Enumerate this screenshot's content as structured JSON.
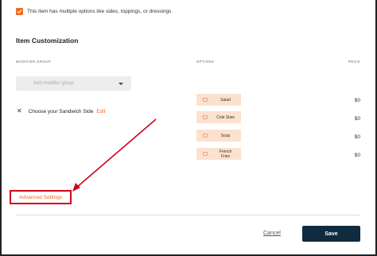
{
  "checkbox": {
    "label": "This item has multiple options like sides, toppings, or dressings",
    "checked": true
  },
  "section": {
    "title": "Item Customization"
  },
  "columns": {
    "modifier_group": "MODIFIER GROUP",
    "options": "OPTIONS",
    "price": "PRICE"
  },
  "modifier_select": {
    "placeholder": "Add modifier group"
  },
  "group": {
    "name": "Choose your Sandwich Side",
    "edit_label": "Edit"
  },
  "options": [
    {
      "label": "Salad",
      "price": "$0"
    },
    {
      "label": "Cole Slaw",
      "price": "$0"
    },
    {
      "label": "Soup",
      "price": "$0"
    },
    {
      "label": "French Fries",
      "price": "$0"
    }
  ],
  "advanced": {
    "label": "Advanced Settings"
  },
  "footer": {
    "cancel_label": "Cancel",
    "save_label": "Save"
  },
  "colors": {
    "accent": "#f26b21",
    "chip_bg": "#fde1cf",
    "annotation_red": "#d0021b",
    "save_bg": "#0f2b40"
  }
}
